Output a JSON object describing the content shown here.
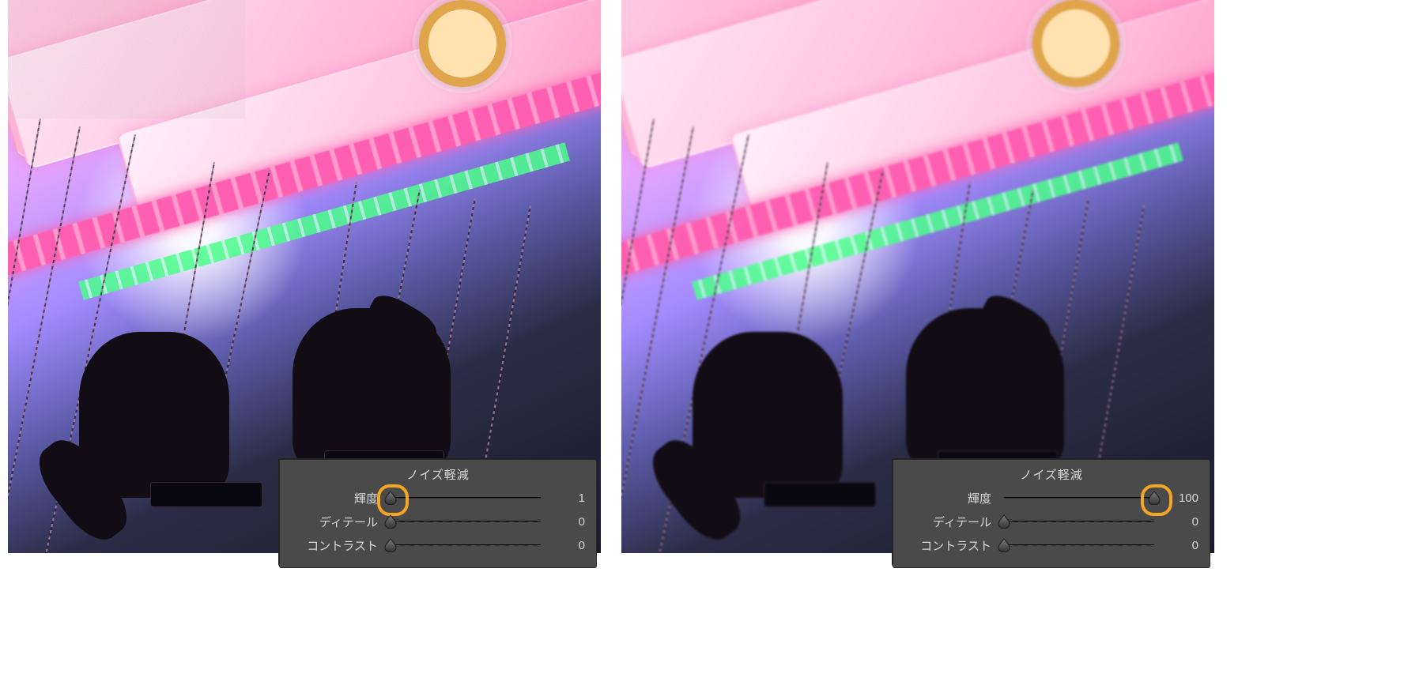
{
  "panels": {
    "title": "ノイズ軽減",
    "sliders": {
      "luminance": {
        "label": "輝度"
      },
      "detail": {
        "label": "ディテール"
      },
      "contrast": {
        "label": "コントラスト"
      }
    }
  },
  "left": {
    "luminance": {
      "value": "1",
      "pos_pct": 4
    },
    "detail": {
      "value": "0",
      "pos_pct": 4
    },
    "contrast": {
      "value": "0",
      "pos_pct": 4
    },
    "highlight": "luminance"
  },
  "right": {
    "luminance": {
      "value": "100",
      "pos_pct": 96
    },
    "detail": {
      "value": "0",
      "pos_pct": 4
    },
    "contrast": {
      "value": "0",
      "pos_pct": 4
    },
    "highlight": "luminance"
  }
}
